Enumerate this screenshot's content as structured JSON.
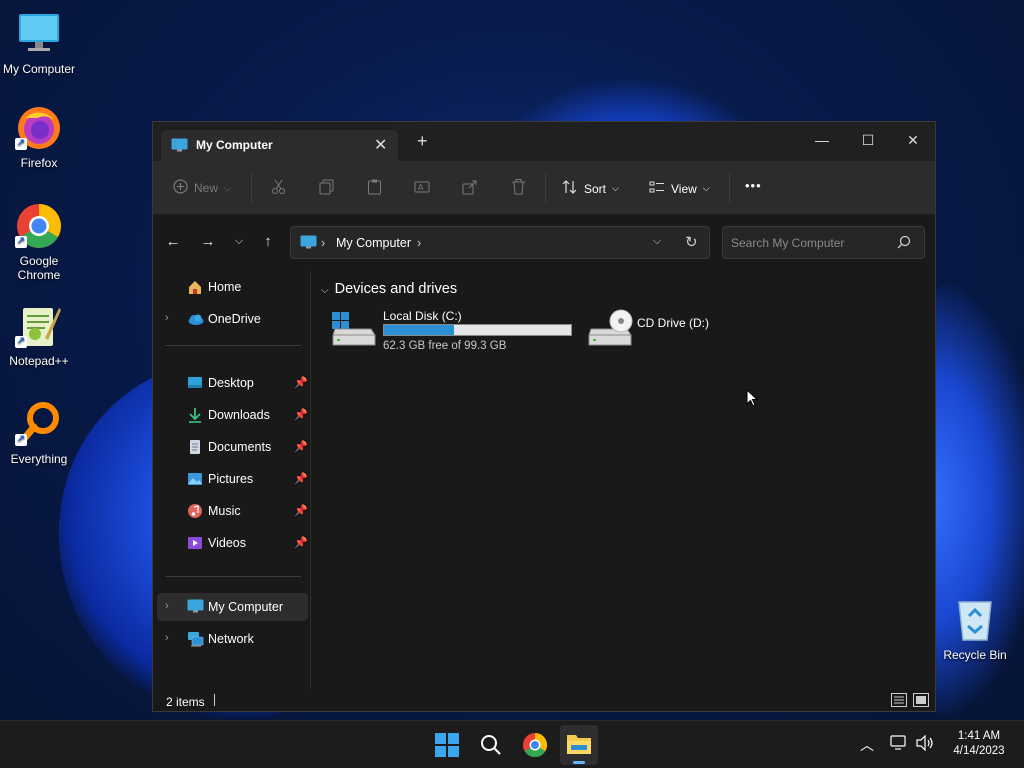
{
  "desktop": {
    "icons": [
      {
        "label": "My Computer"
      },
      {
        "label": "Firefox"
      },
      {
        "label": "Google Chrome"
      },
      {
        "label": "Notepad++"
      },
      {
        "label": "Everything"
      },
      {
        "label": "Recycle Bin"
      }
    ]
  },
  "window": {
    "tab_title": "My Computer",
    "new_tab": "+",
    "controls": {
      "minimize": "—",
      "maximize": "☐",
      "close": "✕"
    }
  },
  "commandbar": {
    "new_label": "New",
    "sort_label": "Sort",
    "view_label": "View",
    "more_label": "•••"
  },
  "address": {
    "crumb": "My Computer",
    "search_placeholder": "Search My Computer"
  },
  "navpane": {
    "home": "Home",
    "onedrive": "OneDrive",
    "quick_access": [
      {
        "label": "Desktop"
      },
      {
        "label": "Downloads"
      },
      {
        "label": "Documents"
      },
      {
        "label": "Pictures"
      },
      {
        "label": "Music"
      },
      {
        "label": "Videos"
      }
    ],
    "my_computer": "My Computer",
    "network": "Network"
  },
  "content": {
    "section_title": "Devices and drives",
    "drives": [
      {
        "name": "Local Disk (C:)",
        "free_text": "62.3 GB free of 99.3 GB",
        "used_fraction": 0.373
      },
      {
        "name": "CD Drive (D:)"
      }
    ]
  },
  "status": {
    "item_count": "2 items"
  },
  "taskbar": {
    "time": "1:41 AM",
    "date": "4/14/2023"
  },
  "colors": {
    "accent": "#2b8fd6",
    "window_bg": "#191919",
    "taskbar_bg": "#1c1c1c"
  }
}
